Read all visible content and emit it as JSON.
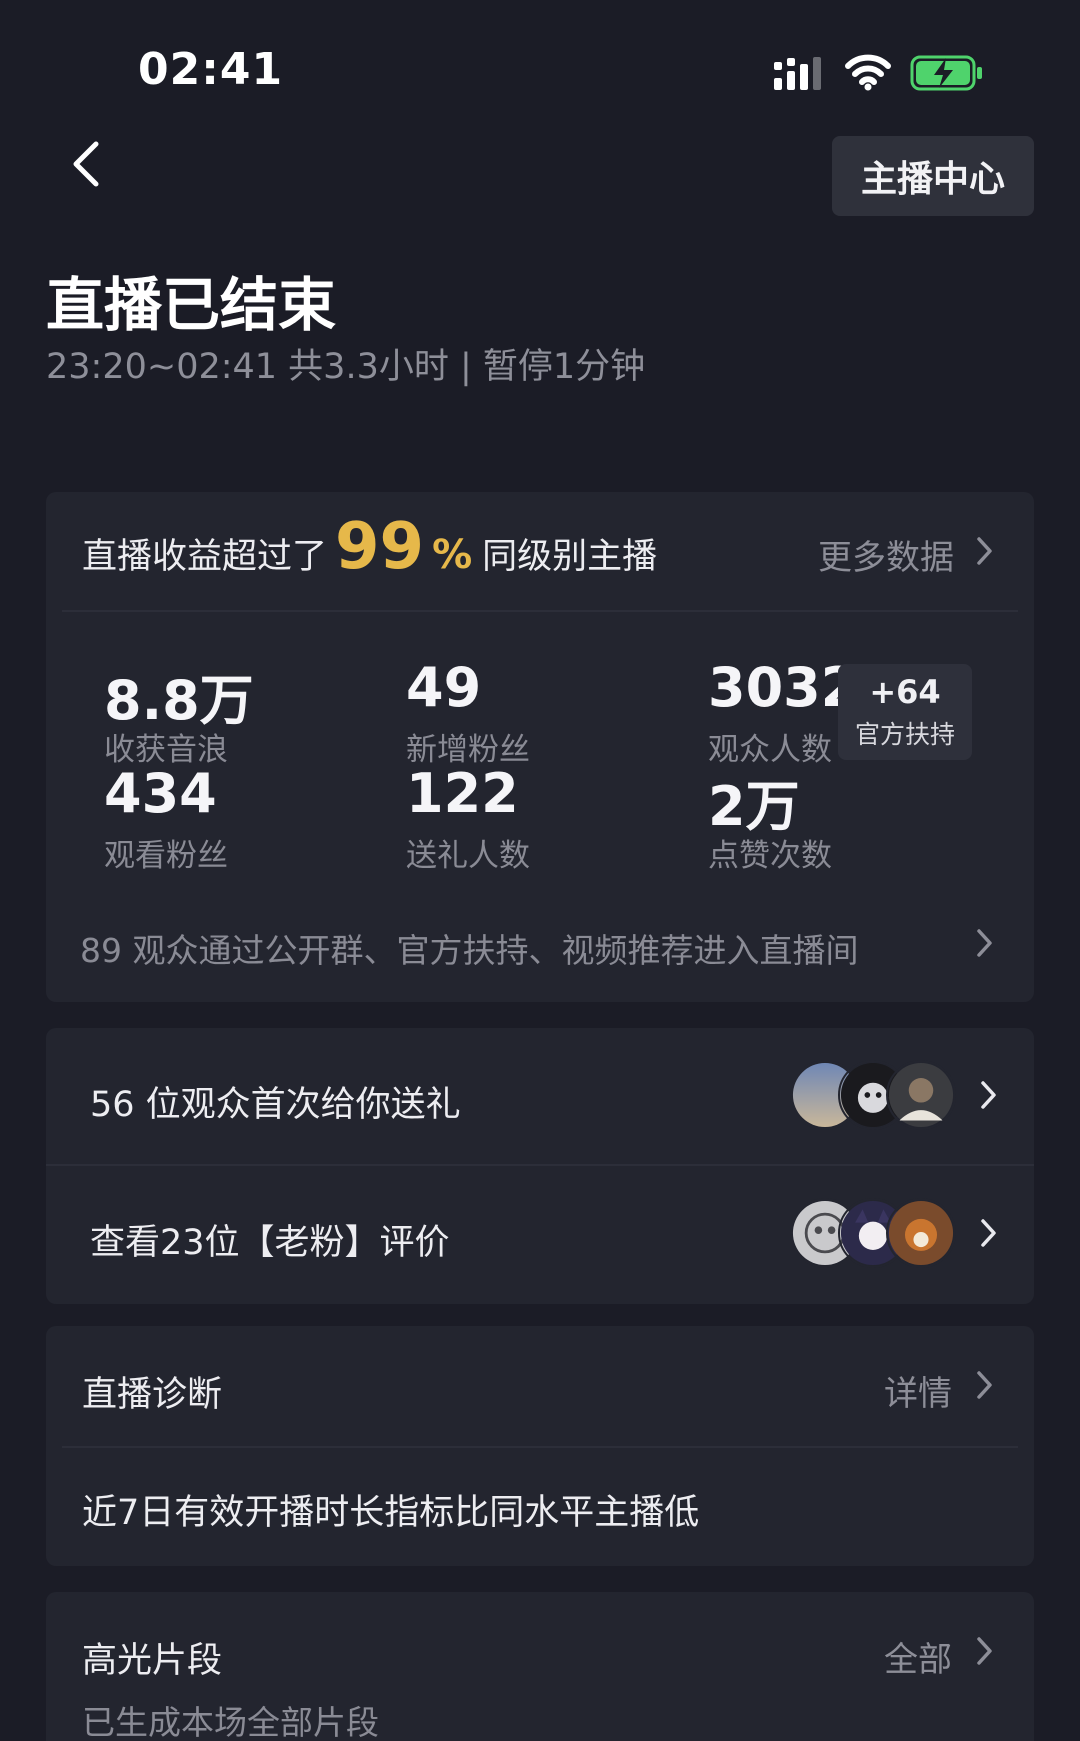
{
  "status_bar": {
    "time": "02:41"
  },
  "header": {
    "anchor_center_label": "主播中心"
  },
  "live_summary": {
    "title": "直播已结束",
    "subtitle": "23:20~02:41 共3.3小时 | 暂停1分钟"
  },
  "stats_card": {
    "rank_prefix": "直播收益超过了",
    "rank_percent": "99",
    "rank_percent_sign": "%",
    "rank_suffix": "同级别主播",
    "more_data_label": "更多数据",
    "stats": [
      {
        "value": "8.8万",
        "label": "收获音浪"
      },
      {
        "value": "49",
        "label": "新增粉丝"
      },
      {
        "value": "3032",
        "label": "观众人数"
      },
      {
        "value": "434",
        "label": "观看粉丝"
      },
      {
        "value": "122",
        "label": "送礼人数"
      },
      {
        "value": "2万",
        "label": "点赞次数"
      }
    ],
    "support_badge": {
      "delta": "+64",
      "label": "官方扶持"
    },
    "entry_note": "89 观众通过公开群、官方扶持、视频推荐进入直播间"
  },
  "gift_card": {
    "first_gift_label": "56 位观众首次给你送礼",
    "reviews_label": "查看23位【老粉】评价"
  },
  "diagnosis_card": {
    "title": "直播诊断",
    "details_label": "详情",
    "message": "近7日有效开播时长指标比同水平主播低"
  },
  "highlights_card": {
    "title": "高光片段",
    "all_label": "全部",
    "note": "已生成本场全部片段"
  }
}
